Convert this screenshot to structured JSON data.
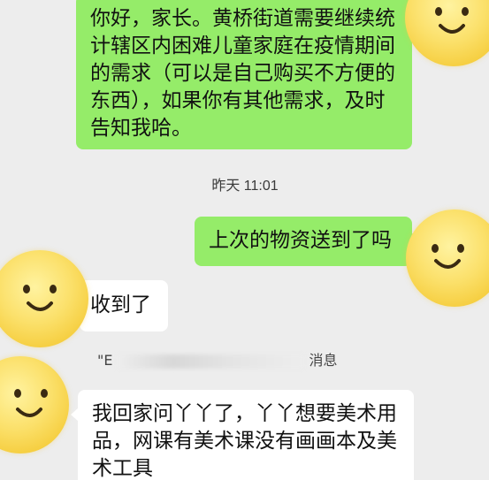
{
  "messages": [
    {
      "side": "right",
      "text": "你好，家长。黄桥街道需要继续统\n计辖区内困难儿童家庭在疫情期间\n的需求（可以是自己购买不方便的\n东西），如果你有其他需求，及时\n告知我哈。"
    },
    {
      "side": "right",
      "text": "上次的物资送到了吗"
    },
    {
      "side": "left",
      "text": "收到了"
    },
    {
      "side": "left",
      "text": "我回家问丫丫了，丫丫想要美术用\n品，网课有美术课没有画画本及美\n术工具"
    }
  ],
  "timestamp": "昨天 11:01",
  "notice": {
    "start": "\"E",
    "end": "消息"
  },
  "avatars": [
    "smiley-face",
    "smiley-face",
    "smiley-face",
    "smiley-face"
  ],
  "colors": {
    "background": "#ededed",
    "outgoing_bubble": "#95ec69",
    "incoming_bubble": "#ffffff",
    "avatar": "#f7d54a"
  }
}
